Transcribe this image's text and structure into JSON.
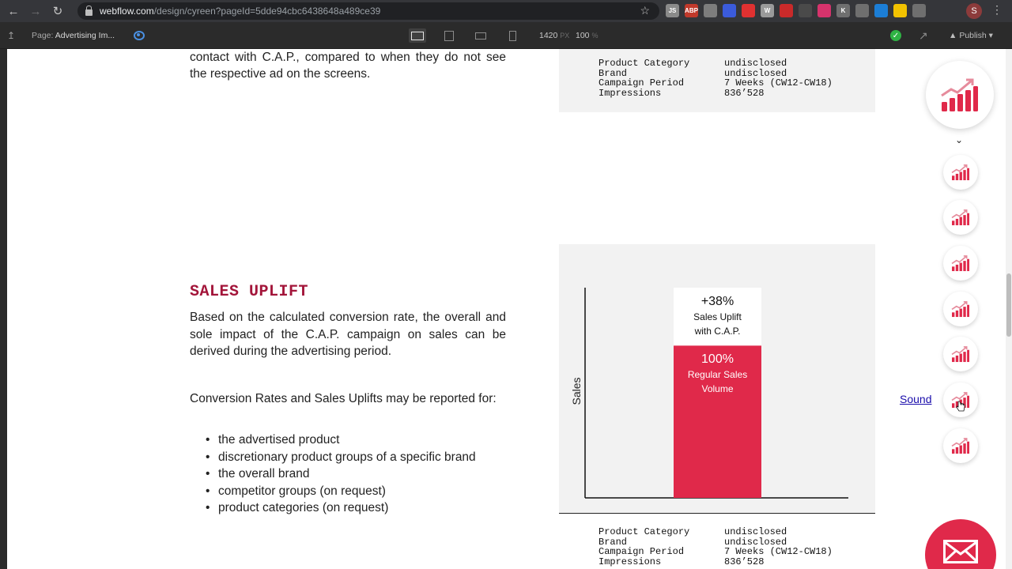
{
  "browser": {
    "url_host": "webflow.com",
    "url_path": "/design/cyreen?pageId=5dde94cbc6438648a489ce39",
    "profile_initial": "S",
    "extensions": [
      {
        "label": "JS",
        "color": "#8a8a8a"
      },
      {
        "label": "ABP",
        "color": "#c0392b"
      },
      {
        "label": "",
        "color": "#7d7d7d"
      },
      {
        "label": "",
        "color": "#3b5bdb"
      },
      {
        "label": "",
        "color": "#e03131"
      },
      {
        "label": "W",
        "color": "#9a9a9a"
      },
      {
        "label": "",
        "color": "#c92a2a"
      },
      {
        "label": "",
        "color": "#4a4a4a"
      },
      {
        "label": "",
        "color": "#d6336c"
      },
      {
        "label": "K",
        "color": "#6f6f6f"
      },
      {
        "label": "",
        "color": "#6f6f6f"
      },
      {
        "label": "",
        "color": "#1c7ed6"
      },
      {
        "label": "",
        "color": "#f2c200"
      },
      {
        "label": "",
        "color": "#6f6f6f"
      }
    ]
  },
  "webflow": {
    "page_prefix": "Page:",
    "page_name": "Advertising Im...",
    "width_value": "1420",
    "width_unit": "PX",
    "zoom_value": "100",
    "zoom_unit": "%",
    "publish_label": "Publish"
  },
  "content": {
    "top_paragraph": "contact with C.A.P., compared to when they do not see the respective ad on the screens.",
    "section_title": "SALES UPLIFT",
    "paragraph_1": "Based on the calculated conversion rate, the overall and sole impact of the C.A.P. campaign on sales can be derived during the advertising period.",
    "paragraph_2": "Conversion Rates and Sales Uplifts may be reported for:",
    "bullets": [
      "the advertised product",
      "discretionary product groups of a specific brand",
      "the overall brand",
      "competitor groups (on request)",
      "product categories (on request)"
    ]
  },
  "specs_top": [
    {
      "key": "Product Category",
      "value": "undisclosed"
    },
    {
      "key": "Brand",
      "value": "undisclosed"
    },
    {
      "key": "Campaign Period",
      "value": "7 Weeks (CW12-CW18)"
    },
    {
      "key": "Impressions",
      "value": "836’528"
    }
  ],
  "specs_bottom": [
    {
      "key": "Product Category",
      "value": "undisclosed"
    },
    {
      "key": "Brand",
      "value": "undisclosed"
    },
    {
      "key": "Campaign Period",
      "value": "7 Weeks (CW12-CW18)"
    },
    {
      "key": "Impressions",
      "value": "836’528"
    }
  ],
  "chart_data": {
    "type": "bar",
    "ylabel": "Sales",
    "xlabel": "",
    "segments": [
      {
        "name": "Regular Sales Volume",
        "value": 100,
        "value_label": "100%",
        "label_line1": "Regular Sales",
        "label_line2": "Volume",
        "color": "#e0294a"
      },
      {
        "name": "Sales Uplift with C.A.P.",
        "value": 38,
        "value_label": "+38%",
        "label_line1": "Sales Uplift",
        "label_line2": "with C.A.P.",
        "color": "#ffffff"
      }
    ],
    "ylim": [
      0,
      138
    ],
    "grid": false
  },
  "rail": {
    "sound_label": "Sound",
    "accent": "#e0294a"
  }
}
